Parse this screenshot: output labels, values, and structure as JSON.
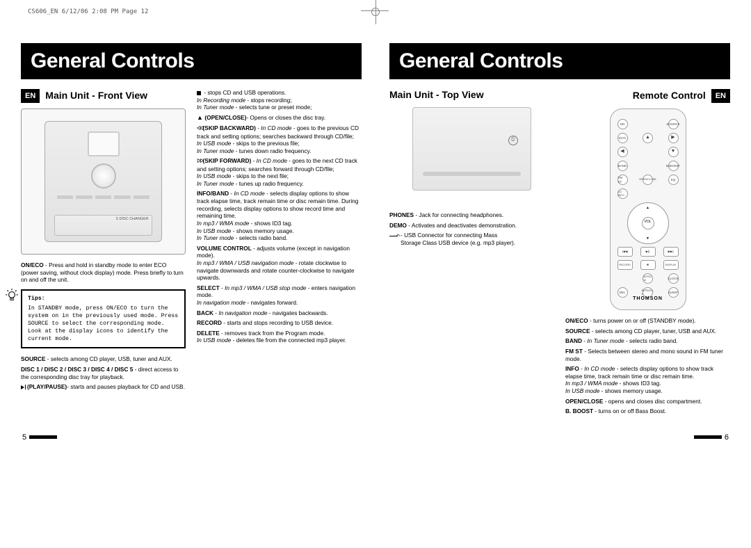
{
  "page_header": "CS606_EN  6/12/06  2:08 PM  Page 12",
  "title": "General Controls",
  "en_badge": "EN",
  "left": {
    "front_view_title": "Main Unit - Front View",
    "tray_label": "5 DISC CHANGER",
    "tips_title": "Tips:",
    "tips_body": "In STANDBY mode, press ON/ECO to turn the system on in the previously used mode. Press SOURCE to select the corresponding mode. Look at the display icons to identify the current mode.",
    "on_eco_b": "ON/ECO",
    "on_eco_t": " -  Press and hold in standby mode to enter ECO (power saving, without clock display) mode. Press briefly to turn on and off the unit.",
    "source_b": "SOURCE",
    "source_t": " - selects among CD player, USB, tuner and AUX.",
    "discs_b": "DISC 1 / DISC 2 / DISC 3 / DISC 4 / DISC 5",
    "discs_t": "  -  direct access to  the corresponding disc tray for playback.",
    "playpause_b": "(PLAY/PAUSE)",
    "playpause_t": "- starts and pauses playback for CD and USB.",
    "stop_t": " - stops CD and USB operations.",
    "stop_rec_i": "In Recording mode",
    "stop_rec_t": " - stops recording;",
    "stop_tuner_i": "In Tuner mode",
    "stop_tuner_t": " - selects tune or preset mode;",
    "openclose_b": "(OPEN/CLOSE)",
    "openclose_t": "-  Opens or closes the disc tray.",
    "skipback_b": "(SKIP BACKWARD)",
    "skipback_cd_i": "In CD mode",
    "skipback_cd_t": " - goes to the previous CD track and setting options; searches backward through CD/file;",
    "skipback_usb_i": "In USB mode",
    "skipback_usb_t": " - skips to the previous file;",
    "skipback_tuner_i": "In Tuner mode",
    "skipback_tuner_t": " - tunes down radio frequency.",
    "skipfwd_b": "(SKIP FORWARD)",
    "skipfwd_cd_i": "In CD mode",
    "skipfwd_cd_t": " - goes to the next CD track and setting options; searches forward through CD/file;",
    "skipfwd_usb_i": "In USB mode",
    "skipfwd_usb_t": " - skips to the next file;",
    "skipfwd_tuner_i": "In Tuner mode",
    "skipfwd_tuner_t": " - tunes up radio frequency.",
    "info_b": "INFO/BAND",
    "info_cd_i": "In CD mode",
    "info_cd_t": " - selects display options to show track elapse time, track remain time or disc remain time. During recording, selects display options to show record time and remaining time.",
    "info_mp3_i": "In mp3 / WMA mode",
    "info_mp3_t": " - shows ID3 tag.",
    "info_usb_i": "In USB mode",
    "info_usb_t": " - shows memory usage.",
    "info_tuner_i": "In Tuner mode",
    "info_tuner_t": " - selects radio band.",
    "vol_b": "VOLUME CONTROL",
    "vol_t": " - adjusts volume (except in navigation mode).",
    "vol_nav_i": "In mp3 / WMA / USB navigation mode",
    "vol_nav_t": " - rotate clockwise to navigate downwards and rotate counter-clockwise to navigate upwards.",
    "select_b": "SELECT",
    "select_i": "In mp3 / WMA / USB stop mode",
    "select_t": " - enters navigation mode.",
    "select_nav_i": "In navigation mode",
    "select_nav_t": " - navigates forward.",
    "back_b": "BACK",
    "back_i": "In navigation mode",
    "back_t": " - navigates backwards.",
    "record_b": "RECORD",
    "record_t": " - starts and stops recording to USB device.",
    "delete_b": "DELETE",
    "delete_t": " - removes track from the Program mode.",
    "delete_usb_i": "In USB mode",
    "delete_usb_t": " - deletes file from the connected mp3 player."
  },
  "right": {
    "top_view_title": "Main Unit - Top View",
    "remote_title": "Remote Control",
    "phones_b": "PHONES",
    "phones_t": " - Jack for connecting headphones.",
    "demo_b": "DEMO",
    "demo_t": " - Activates and deactivates demonstration.",
    "usb_l1": " - USB Connector for connecting Mass",
    "usb_l2": "Storage Class USB device (e.g. mp3 player).",
    "remote_brand": "THOMSON",
    "btn_on": "ON",
    "btn_source": "SOURCE",
    "btn_eco": "ECO",
    "btn_band": "BAND",
    "btn_bboost": "B.BOOST",
    "btn_fmst": "FM ST",
    "btn_open": "OPEN/CLOSE",
    "btn_eq": "EQ",
    "btn_cdinfo": "CD INFO",
    "btn_vol": "VOL",
    "btn_record": "RECORD",
    "btn_display": "DISPLAY",
    "btn_intro": "INTRO 10",
    "btn_clock": "CLOCK",
    "btn_del": "DEL",
    "btn_repeat": "REPEAT/1-6",
    "btn_sleep": "SLEEP",
    "rc_oneco_b": "ON/ECO",
    "rc_oneco_t": " - turns power on or off (STANDBY mode).",
    "rc_source_b": "SOURCE",
    "rc_source_t": " - selects among CD player, tuner, USB and AUX.",
    "rc_band_b": "BAND",
    "rc_band_i": "In Tuner mode",
    "rc_band_t": " - selects radio band.",
    "rc_fmst_b": "FM ST",
    "rc_fmst_t": " - Selects between stereo and mono sound in FM tuner mode.",
    "rc_info_b": "INFO",
    "rc_info_cd_i": "In CD mode",
    "rc_info_cd_t": " - selects  display options to show track elapse time, track remain time or disc remain time.",
    "rc_info_mp3_i": "In mp3 / WMA mode",
    "rc_info_mp3_t": " - shows ID3 tag.",
    "rc_info_usb_i": "In USB mode",
    "rc_info_usb_t": " - shows memory usage.",
    "rc_open_b": "OPEN/CLOSE",
    "rc_open_t": " - opens and closes disc compartment.",
    "rc_bboost_b": "B. BOOST",
    "rc_bboost_t": " - turns on or off Bass Boost."
  },
  "page_num_left": "5",
  "page_num_right": "6"
}
